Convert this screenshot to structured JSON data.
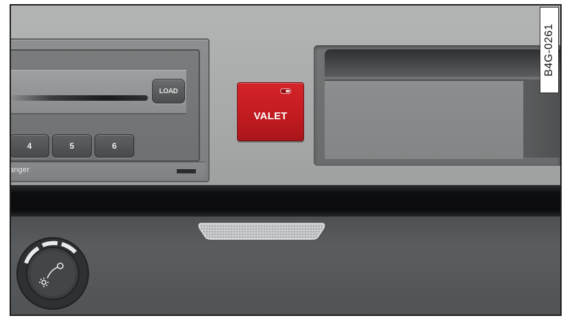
{
  "figure_code": "B4G-0261",
  "radio": {
    "load_label": "LOAD",
    "presets": [
      "4",
      "5",
      "6"
    ],
    "changer_label": "anger"
  },
  "valet_button": {
    "label": "VALET"
  },
  "colors": {
    "valet_red": "#c71d22",
    "panel_gray": "#a9abab",
    "dash_black": "#0b0c0d",
    "lower_panel": "#5a5d5f"
  },
  "icons": {
    "valet_led": "valet-led-icon",
    "light_switch": "headlight-switch-icon"
  }
}
